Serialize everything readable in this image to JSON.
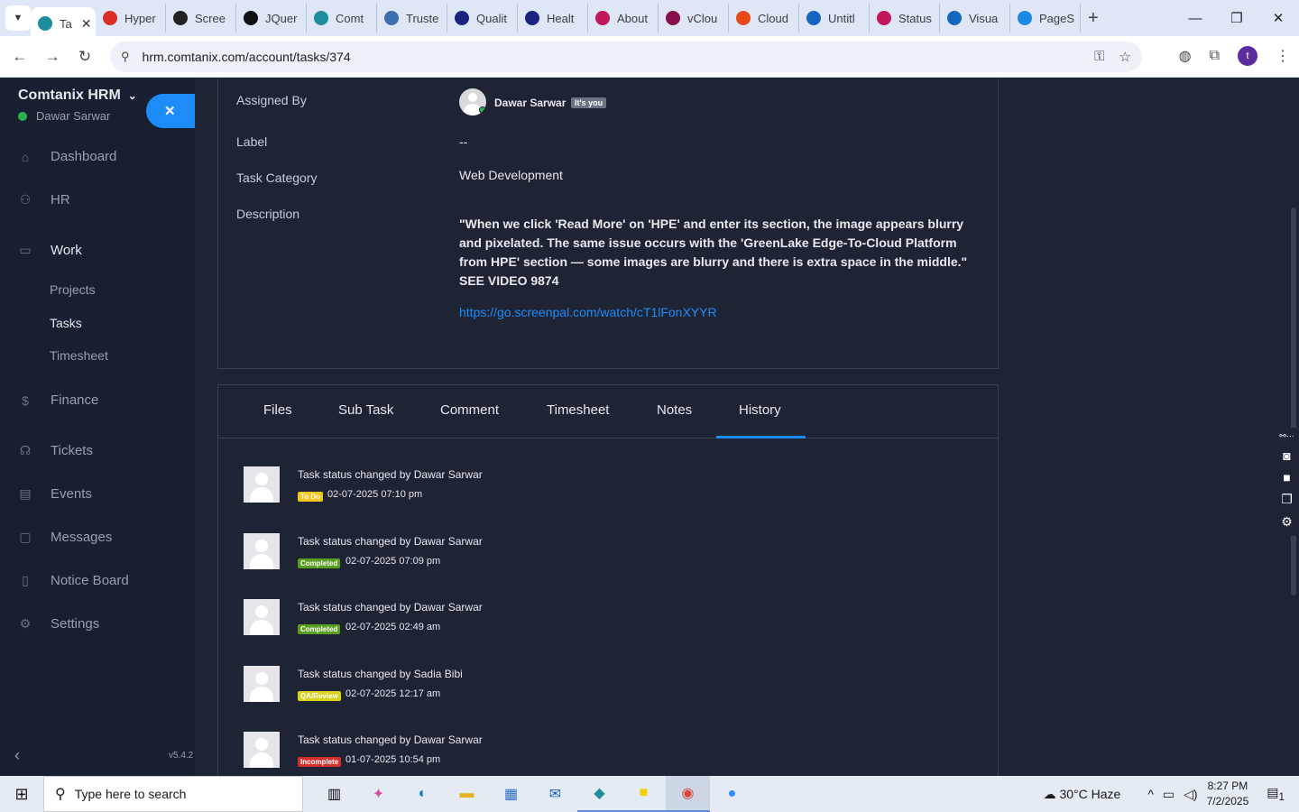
{
  "browser": {
    "tabs": [
      {
        "label": "Ta",
        "color": "#1e8e9e",
        "active": true
      },
      {
        "label": "Hyper",
        "color": "#d93025"
      },
      {
        "label": "Scree",
        "color": "#222222"
      },
      {
        "label": "JQuer",
        "color": "#111111"
      },
      {
        "label": "Comt",
        "color": "#1e8e9e"
      },
      {
        "label": "Truste",
        "color": "#3a6fb0"
      },
      {
        "label": "Qualit",
        "color": "#1a237e"
      },
      {
        "label": "Healt",
        "color": "#1a237e"
      },
      {
        "label": "About",
        "color": "#c2185b"
      },
      {
        "label": "vClou",
        "color": "#880e4f"
      },
      {
        "label": "Cloud",
        "color": "#e64a19"
      },
      {
        "label": "Untitl",
        "color": "#1565c0"
      },
      {
        "label": "Status",
        "color": "#c2185b"
      },
      {
        "label": "Visua",
        "color": "#1565c0"
      },
      {
        "label": "PageS",
        "color": "#1e88e5"
      }
    ],
    "url": "hrm.comtanix.com/account/tasks/374",
    "profile_initial": "t"
  },
  "sidebar": {
    "brand": "Comtanix HRM",
    "user": "Dawar Sarwar",
    "items": [
      {
        "label": "Dashboard",
        "icon": "home-icon",
        "glyph": "⌂"
      },
      {
        "label": "HR",
        "icon": "people-icon",
        "glyph": "⚇"
      },
      {
        "label": "Work",
        "icon": "briefcase-icon",
        "glyph": "▭"
      },
      {
        "label": "Finance",
        "icon": "dollar-icon",
        "glyph": "$"
      },
      {
        "label": "Tickets",
        "icon": "headset-icon",
        "glyph": "☊"
      },
      {
        "label": "Events",
        "icon": "calendar-icon",
        "glyph": "▤"
      },
      {
        "label": "Messages",
        "icon": "message-icon",
        "glyph": "▢"
      },
      {
        "label": "Notice Board",
        "icon": "clipboard-icon",
        "glyph": "▯"
      },
      {
        "label": "Settings",
        "icon": "gear-icon",
        "glyph": "⚙"
      }
    ],
    "subitems": [
      "Projects",
      "Tasks",
      "Timesheet"
    ],
    "version": "v5.4.2"
  },
  "task": {
    "assigned_by_label": "Assigned By",
    "assigned_by_name": "Dawar Sarwar",
    "its_you": "It's you",
    "label_label": "Label",
    "label_value": "--",
    "category_label": "Task Category",
    "category_value": "Web Development",
    "description_label": "Description",
    "description": "\"When we click 'Read More' on 'HPE' and enter its section, the image appears blurry and pixelated. The same issue occurs with the 'GreenLake Edge-To-Cloud Platform from HPE' section — some images are blurry and there is extra space in the middle.\" SEE VIDEO 9874",
    "link": "https://go.screenpal.com/watch/cT1lFonXYYR"
  },
  "tabs": [
    "Files",
    "Sub Task",
    "Comment",
    "Timesheet",
    "Notes",
    "History"
  ],
  "history": [
    {
      "title": "Task status changed by Dawar Sarwar",
      "badge": "To Do",
      "badge_color": "#f5c518",
      "time": "02-07-2025 07:10 pm"
    },
    {
      "title": "Task status changed by Dawar Sarwar",
      "badge": "Completed",
      "badge_color": "#5a9e1e",
      "time": "02-07-2025 07:09 pm"
    },
    {
      "title": "Task status changed by Dawar Sarwar",
      "badge": "Completed",
      "badge_color": "#5a9e1e",
      "time": "02-07-2025 02:49 am"
    },
    {
      "title": "Task status changed by Sadia Bibi",
      "badge": "QA/Review",
      "badge_color": "#d8d318",
      "time": "02-07-2025 12:17 am"
    },
    {
      "title": "Task status changed by Dawar Sarwar",
      "badge": "Incomplete",
      "badge_color": "#d32f2f",
      "time": "01-07-2025 10:54 pm"
    }
  ],
  "taskbar": {
    "search_placeholder": "Type here to search",
    "weather": "30°C Haze",
    "time": "8:27 PM",
    "date": "7/2/2025",
    "notif_count": "1"
  }
}
